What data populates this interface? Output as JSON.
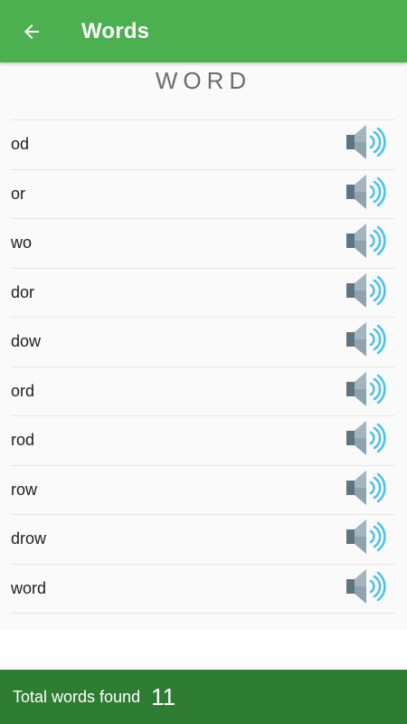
{
  "toolbar": {
    "title": "Words",
    "back_icon": "arrow-left-icon",
    "color": "#4caf50"
  },
  "heading": "WORD",
  "words": [
    {
      "text": "od",
      "icon": "speaker-icon"
    },
    {
      "text": "or",
      "icon": "speaker-icon"
    },
    {
      "text": "wo",
      "icon": "speaker-icon"
    },
    {
      "text": "dor",
      "icon": "speaker-icon"
    },
    {
      "text": "dow",
      "icon": "speaker-icon"
    },
    {
      "text": "ord",
      "icon": "speaker-icon"
    },
    {
      "text": "rod",
      "icon": "speaker-icon"
    },
    {
      "text": "row",
      "icon": "speaker-icon"
    },
    {
      "text": "drow",
      "icon": "speaker-icon"
    },
    {
      "text": "word",
      "icon": "speaker-icon"
    }
  ],
  "footer": {
    "label": "Total words found",
    "count": "11",
    "color": "#2e7d32"
  }
}
